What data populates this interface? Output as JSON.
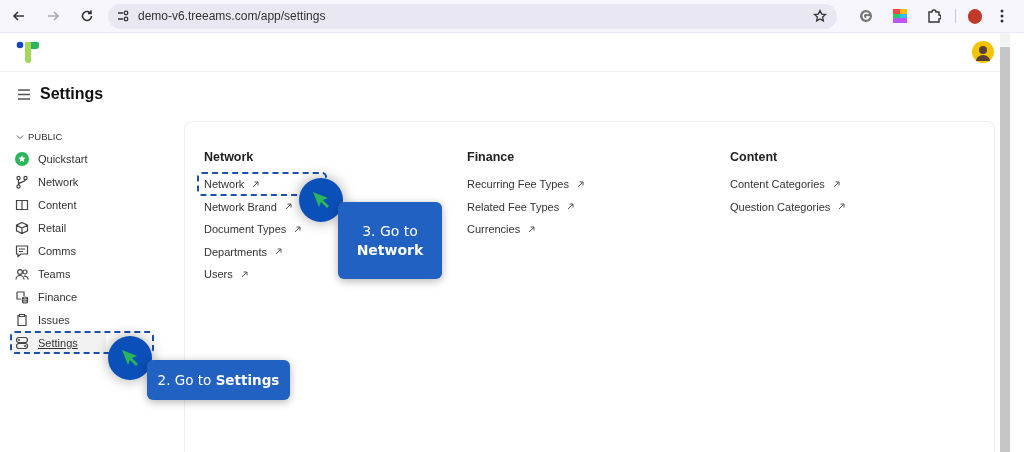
{
  "browser": {
    "url": "demo-v6.treeams.com/app/settings"
  },
  "page": {
    "title": "Settings"
  },
  "sidebar": {
    "section": {
      "label": "PUBLIC",
      "expanded": true
    },
    "items": [
      {
        "label": "Quickstart",
        "selected": false
      },
      {
        "label": "Network",
        "selected": false
      },
      {
        "label": "Content",
        "selected": false
      },
      {
        "label": "Retail",
        "selected": false
      },
      {
        "label": "Comms",
        "selected": false
      },
      {
        "label": "Teams",
        "selected": false
      },
      {
        "label": "Finance",
        "selected": false
      },
      {
        "label": "Issues",
        "selected": false
      },
      {
        "label": "Settings",
        "selected": true
      }
    ]
  },
  "settings_groups": [
    {
      "title": "Network",
      "links": [
        "Network",
        "Network Brand",
        "Document Types",
        "Departments",
        "Users"
      ]
    },
    {
      "title": "Finance",
      "links": [
        "Recurring Fee Types",
        "Related Fee Types",
        "Currencies"
      ]
    },
    {
      "title": "Content",
      "links": [
        "Content Categories",
        "Question Categories"
      ]
    }
  ],
  "tutorial_steps": [
    {
      "text": "2. Go to **Settings**"
    },
    {
      "text": "3. Go to **Network**"
    }
  ]
}
